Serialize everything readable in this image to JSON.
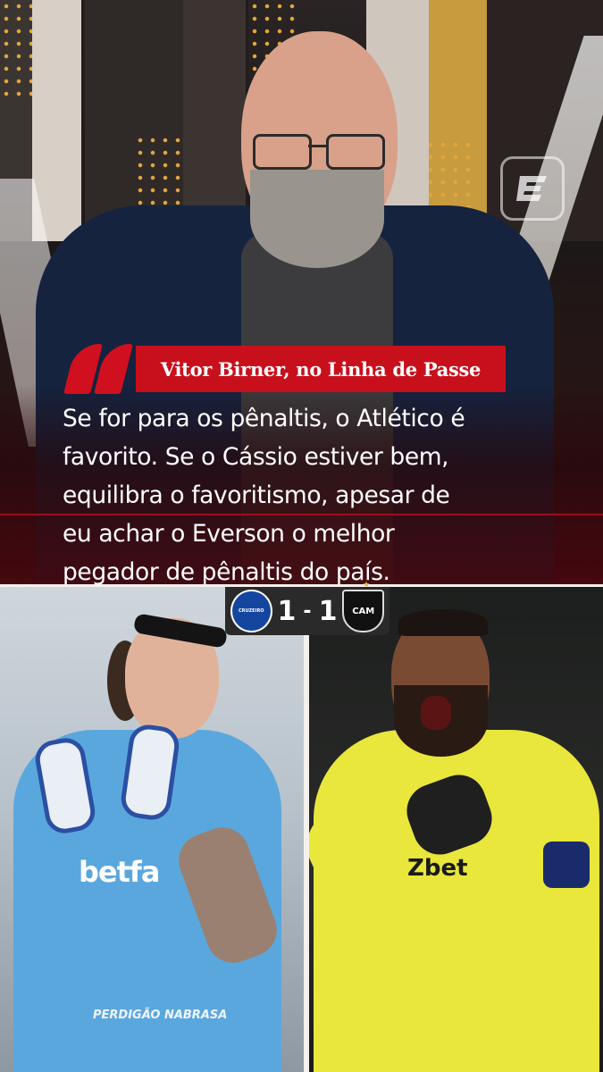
{
  "quote": {
    "source": "Vitor Birner, no Linha de Passe",
    "lines": [
      "Se for para os pênaltis, o Atlético é",
      "favorito. Se o Cássio estiver bem,",
      "equilibra o favoritismo, apesar de",
      "eu achar o Everson o melhor",
      "pegador de pênaltis do país."
    ]
  },
  "scoreboard": {
    "home_score": "1",
    "separator": "-",
    "away_score": "1",
    "home_crest_text": "CRUZEIRO",
    "away_crest_text": "CAM"
  },
  "players": {
    "left_sponsor": "betfa",
    "left_sponsor_small": "PERDIGÃO NABRASA",
    "right_sponsor": "Zbet"
  },
  "colors": {
    "accent_red": "#c8101d",
    "cruzeiro_blue": "#1446a0",
    "atletico_yellow": "#e9e63c"
  }
}
